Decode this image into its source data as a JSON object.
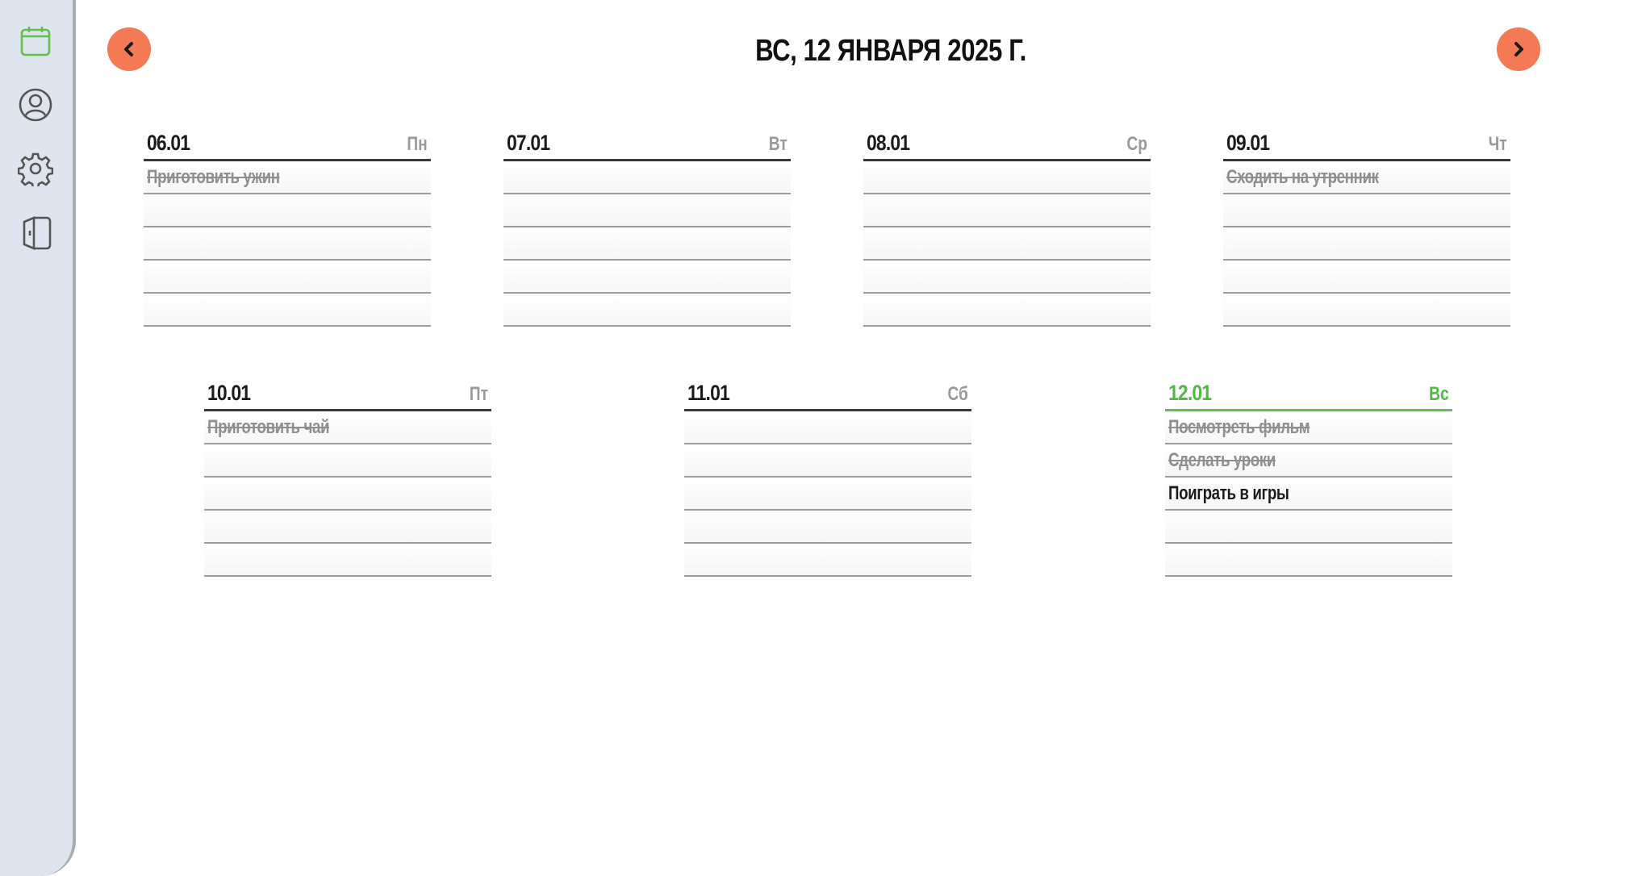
{
  "app": {
    "sidebar": [
      {
        "name": "calendar-icon",
        "active_color": "#5fc04a"
      },
      {
        "name": "profile-icon"
      },
      {
        "name": "settings-icon"
      },
      {
        "name": "logout-icon"
      }
    ]
  },
  "header": {
    "title": "ВС, 12 ЯНВАРЯ 2025 Г.",
    "prev_icon": "chevron-left-icon",
    "next_icon": "chevron-right-icon",
    "nav_color": "#f47a55"
  },
  "week": [
    {
      "date": "06.01",
      "weekday": "Пн",
      "tasks": [
        {
          "text": "Приготовить ужин",
          "done": true
        },
        {
          "text": "",
          "done": false
        },
        {
          "text": "",
          "done": false
        },
        {
          "text": "",
          "done": false
        },
        {
          "text": "",
          "done": false
        }
      ]
    },
    {
      "date": "07.01",
      "weekday": "Вт",
      "tasks": [
        {
          "text": "",
          "done": false
        },
        {
          "text": "",
          "done": false
        },
        {
          "text": "",
          "done": false
        },
        {
          "text": "",
          "done": false
        },
        {
          "text": "",
          "done": false
        }
      ]
    },
    {
      "date": "08.01",
      "weekday": "Ср",
      "tasks": [
        {
          "text": "",
          "done": false
        },
        {
          "text": "",
          "done": false
        },
        {
          "text": "",
          "done": false
        },
        {
          "text": "",
          "done": false
        },
        {
          "text": "",
          "done": false
        }
      ]
    },
    {
      "date": "09.01",
      "weekday": "Чт",
      "tasks": [
        {
          "text": "Сходить на утренник",
          "done": true
        },
        {
          "text": "",
          "done": false
        },
        {
          "text": "",
          "done": false
        },
        {
          "text": "",
          "done": false
        },
        {
          "text": "",
          "done": false
        }
      ]
    },
    {
      "date": "10.01",
      "weekday": "Пт",
      "tasks": [
        {
          "text": "Приготовить чай",
          "done": true
        },
        {
          "text": "",
          "done": false
        },
        {
          "text": "",
          "done": false
        },
        {
          "text": "",
          "done": false
        },
        {
          "text": "",
          "done": false
        }
      ]
    },
    {
      "date": "11.01",
      "weekday": "Сб",
      "tasks": [
        {
          "text": "",
          "done": false
        },
        {
          "text": "",
          "done": false
        },
        {
          "text": "",
          "done": false
        },
        {
          "text": "",
          "done": false
        },
        {
          "text": "",
          "done": false
        }
      ]
    },
    {
      "date": "12.01",
      "weekday": "Вс",
      "today": true,
      "tasks": [
        {
          "text": "Посмотреть фильм",
          "done": true
        },
        {
          "text": "Сделать уроки",
          "done": true
        },
        {
          "text": "Поиграть в игры",
          "done": false
        },
        {
          "text": "",
          "done": false
        },
        {
          "text": "",
          "done": false
        }
      ]
    }
  ]
}
